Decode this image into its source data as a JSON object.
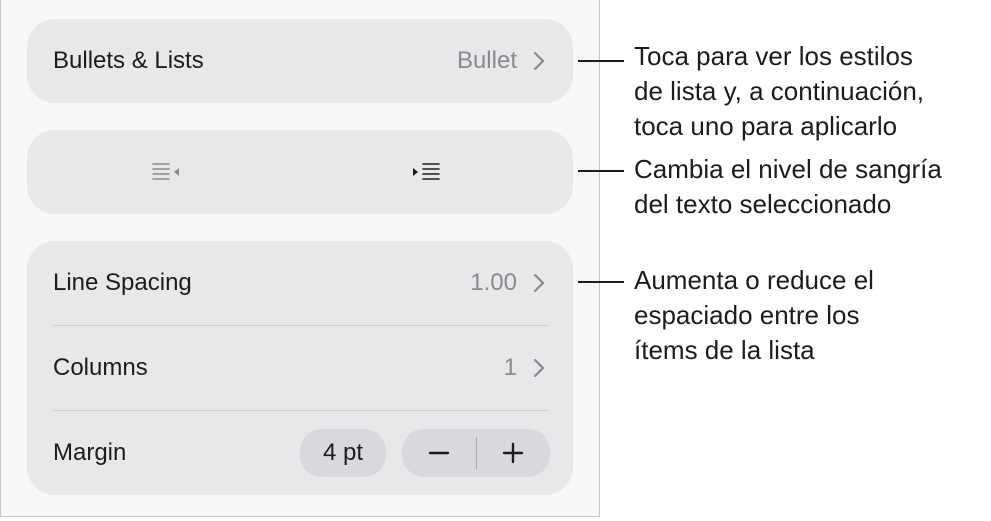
{
  "bullets": {
    "label": "Bullets & Lists",
    "value": "Bullet",
    "chevron_icon": "chevron-right-icon"
  },
  "indent": {
    "decrease_icon": "decrease-indent-icon",
    "increase_icon": "increase-indent-icon"
  },
  "spacing": {
    "line_spacing_label": "Line Spacing",
    "line_spacing_value": "1.00",
    "columns_label": "Columns",
    "columns_value": "1",
    "margin_label": "Margin",
    "margin_value": "4 pt",
    "minus_icon": "minus-icon",
    "plus_icon": "plus-icon"
  },
  "callouts": {
    "bullets": [
      "Toca para ver los estilos",
      "de lista y, a continuación,",
      "toca uno para aplicarlo"
    ],
    "indent": [
      "Cambia el nivel de sangría",
      "del texto seleccionado"
    ],
    "spacing": [
      "Aumenta o reduce el",
      "espaciado entre los",
      "ítems de la lista"
    ]
  },
  "colors": {
    "panel_background": "#f7f7f7",
    "group_background": "#e8e8ea",
    "control_background": "#d9d9dd",
    "secondary_text": "#8a8a8e",
    "primary_text": "#1c1c1e"
  }
}
